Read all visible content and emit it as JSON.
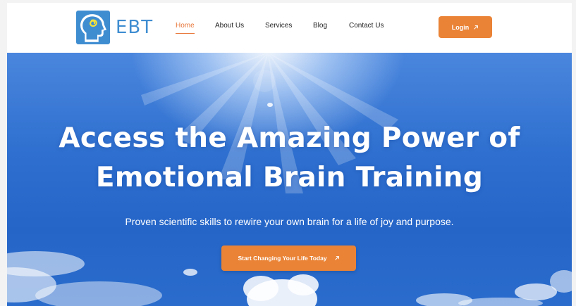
{
  "brand": {
    "name": "EBT",
    "logo_icon": "head-profile-icon",
    "color": "#3f8dd1"
  },
  "nav": {
    "items": [
      {
        "label": "Home",
        "active": true
      },
      {
        "label": "About Us",
        "active": false
      },
      {
        "label": "Services",
        "active": false
      },
      {
        "label": "Blog",
        "active": false
      },
      {
        "label": "Contact Us",
        "active": false
      }
    ],
    "active_color": "#e8773a"
  },
  "header": {
    "login_label": "Login",
    "login_icon": "arrow-up-right-icon"
  },
  "hero": {
    "title_line1": "Access the Amazing Power of",
    "title_line2": "Emotional Brain Training",
    "subtitle": "Proven scientific skills to rewire your own brain for a life of joy and purpose.",
    "cta_label": "Start Changing Your Life Today",
    "cta_icon": "arrow-up-right-icon",
    "background": "sunlit-sky-with-clouds"
  },
  "colors": {
    "accent": "#ea8336",
    "sky": "#2e6fcf"
  }
}
